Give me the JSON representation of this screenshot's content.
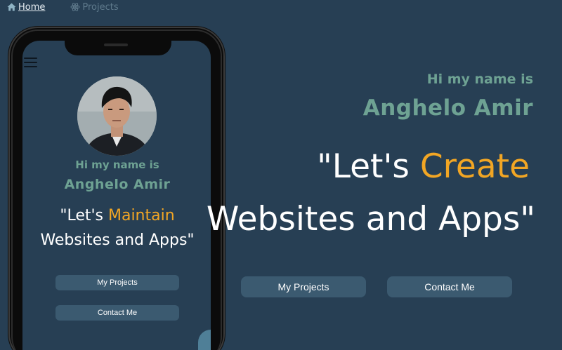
{
  "nav": {
    "home_label": "Home",
    "projects_label": "Projects",
    "home_icon": "home-icon",
    "projects_icon": "react-atom-icon"
  },
  "mobile_preview": {
    "greeting": "Hi my name is",
    "name": "Anghelo Amir",
    "quote_prefix": "\"Let's ",
    "quote_accent": "Maintain",
    "quote_line2": "Websites and Apps\"",
    "button_projects": "My Projects",
    "button_contact": "Contact Me"
  },
  "hero": {
    "greeting": "Hi my name is",
    "name": "Anghelo Amir",
    "quote_prefix": "\"Let's ",
    "quote_accent": "Create",
    "quote_line2": "Websites and Apps\"",
    "button_projects": "My Projects",
    "button_contact": "Contact Me"
  },
  "colors": {
    "background": "#273f54",
    "accent": "#f2a624",
    "name_green": "#6ea293",
    "button_bg": "#3b5a70"
  }
}
